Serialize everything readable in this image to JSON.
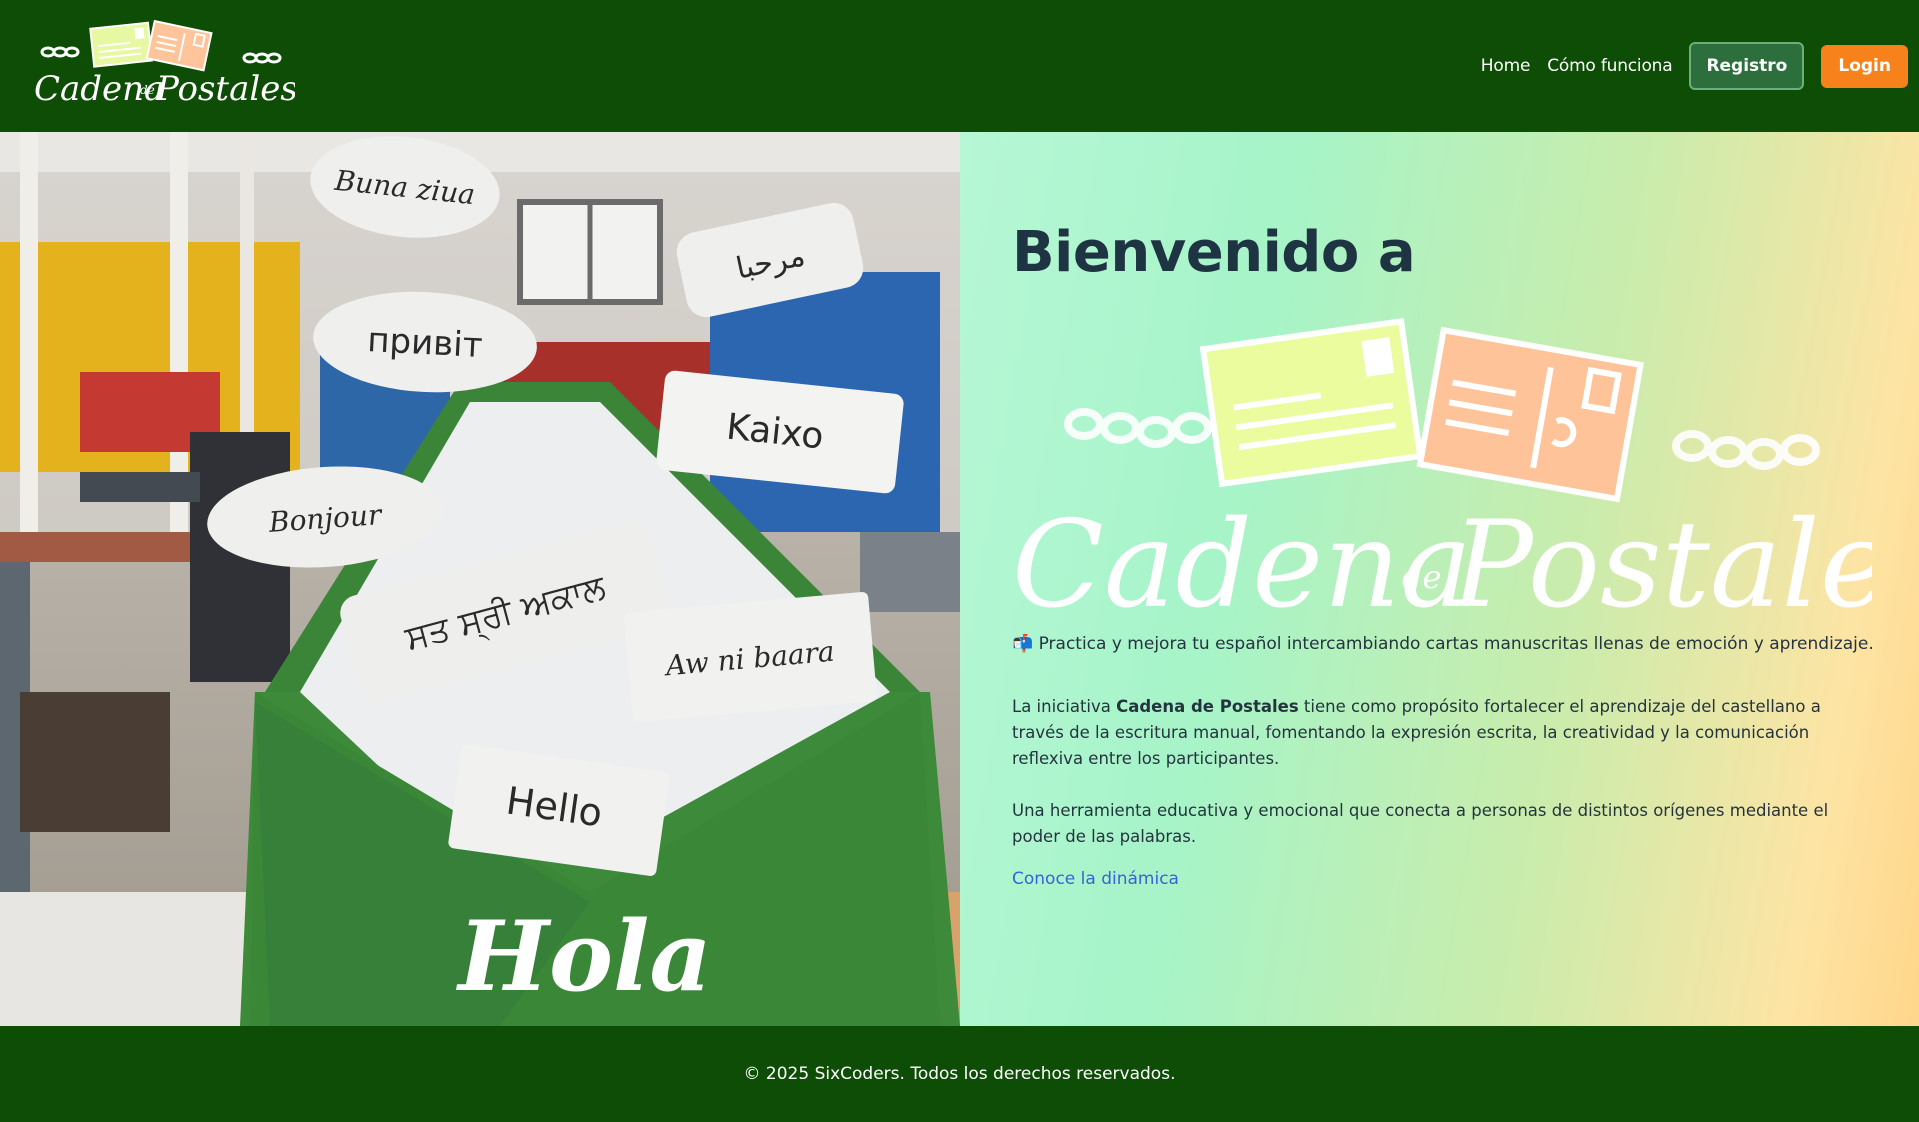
{
  "header": {
    "logo_alt": "Cadena de Postales",
    "nav": {
      "home": "Home",
      "how_it_works": "Cómo funciona",
      "register": "Registro",
      "login": "Login"
    }
  },
  "hero": {
    "image_words": [
      "Buna ziua",
      "مرحبا",
      "привіт",
      "Kaixo",
      "Bonjour",
      "ਸਤ ਸ੍ਰੀ ਅਕਾਲ",
      "Aw ni baara",
      "Hello",
      "Hola"
    ],
    "title": "Bienvenido a",
    "logo_text_main_left": "Cadena",
    "logo_text_small": "de",
    "logo_text_main_right": "Postales",
    "tagline_icon": "📬",
    "tagline": "Practica y mejora tu español intercambiando cartas manuscritas llenas de emoción y aprendizaje.",
    "para1_before": "La iniciativa ",
    "para1_bold": "Cadena de Postales",
    "para1_after": " tiene como propósito fortalecer el aprendizaje del castellano a través de la escritura manual, fomentando la expresión escrita, la creatividad y la comunicación reflexiva entre los participantes.",
    "para2": "Una herramienta educativa y emocional que conecta a personas de distintos orígenes mediante el poder de las palabras.",
    "link": "Conoce la dinámica"
  },
  "footer": {
    "copyright": "© 2025 SixCoders. Todos los derechos reservados."
  },
  "colors": {
    "header_bg": "#0d4d05",
    "login_btn": "#f7821b",
    "register_btn": "#2c6e3c",
    "link": "#3a62d8"
  }
}
